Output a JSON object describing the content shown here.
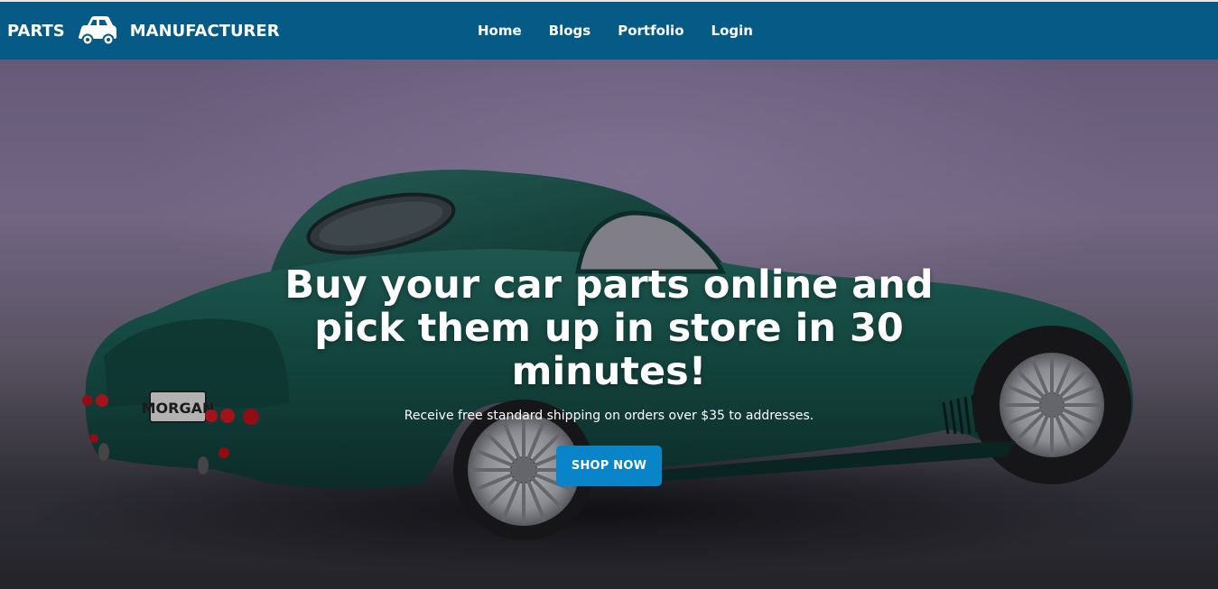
{
  "brand": {
    "left_text": "PARTS",
    "right_text": "MANUFACTURER",
    "icon": "car-icon"
  },
  "nav": {
    "items": [
      {
        "label": "Home"
      },
      {
        "label": "Blogs"
      },
      {
        "label": "Portfolio"
      },
      {
        "label": "Login"
      }
    ]
  },
  "hero": {
    "title": "Buy your car parts online and pick them up in store in 30 minutes!",
    "subtitle": "Receive free standard shipping on orders over $35 to addresses.",
    "button_label": "SHOP NOW",
    "background_image": "green-sports-car-photo"
  },
  "colors": {
    "navbar": "#065a86",
    "button": "#0a84c8",
    "text": "#ffffff"
  }
}
